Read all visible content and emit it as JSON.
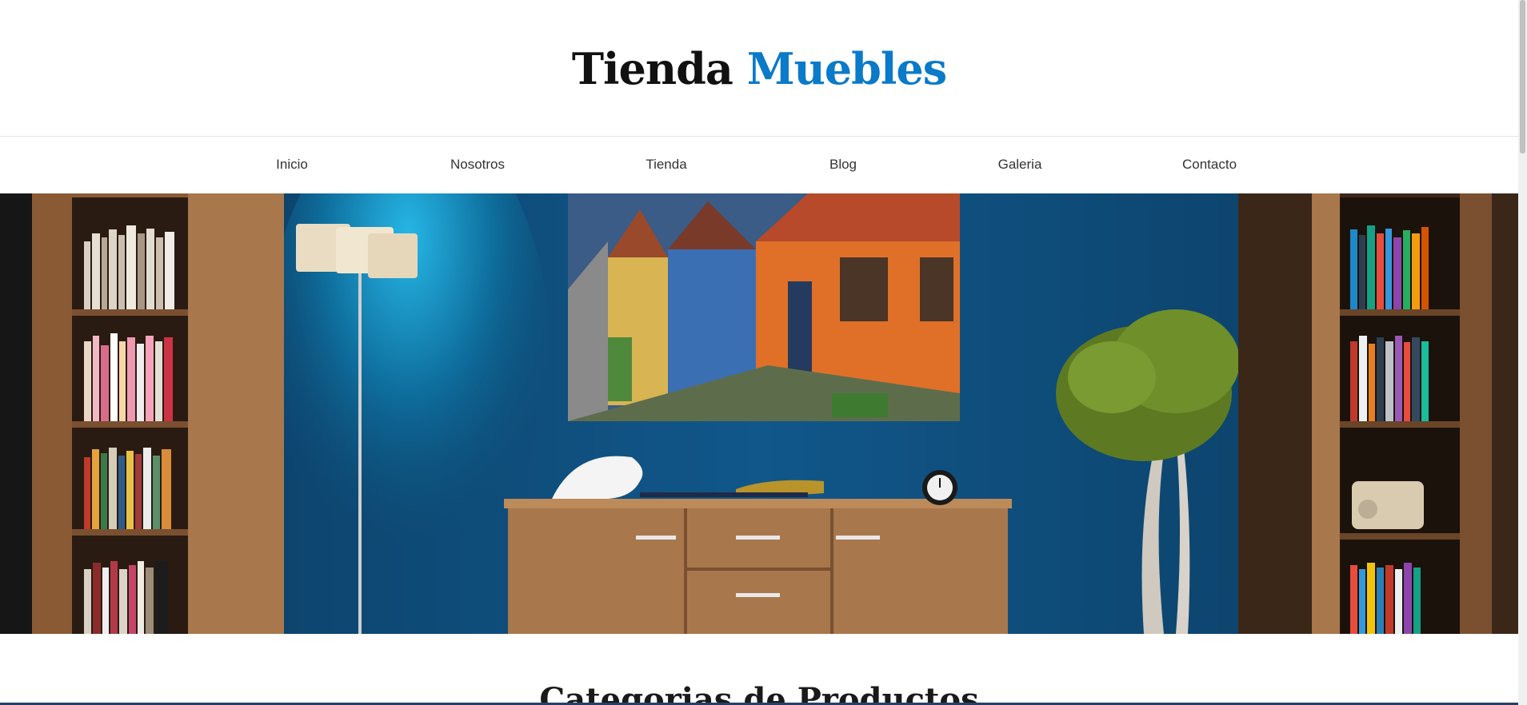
{
  "header": {
    "logo_main": "Tienda",
    "logo_accent": "Muebles",
    "accent_color": "#0a7ac9"
  },
  "nav": {
    "items": [
      {
        "label": "Inicio"
      },
      {
        "label": "Nosotros"
      },
      {
        "label": "Tienda"
      },
      {
        "label": "Blog"
      },
      {
        "label": "Galeria"
      },
      {
        "label": "Contacto"
      }
    ]
  },
  "section": {
    "title": "Categorias de Productos"
  },
  "colors": {
    "wall": "#0e4a74",
    "wood": "#a8774c",
    "text": "#333333"
  }
}
